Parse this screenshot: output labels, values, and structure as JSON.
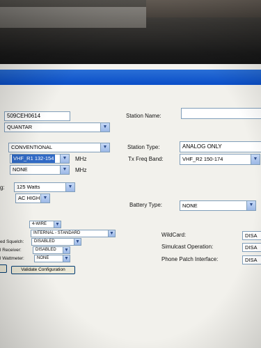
{
  "form": {
    "serial_value": "509CEH0614",
    "model_value": "QUANTAR",
    "station_name_label": "Station Name:",
    "station_name_value": "",
    "mode_value": "CONVENTIONAL",
    "station_type_label": "Station Type:",
    "station_type_value": "ANALOG ONLY",
    "rx_band_value": "VHF_R1  132-154",
    "rx_band_unit": "MHz",
    "tx_freq_band_label": "Tx Freq Band:",
    "tx_freq_band_value": "VHF_R2  150-174",
    "second_band_value": "NONE",
    "second_band_unit": "MHz",
    "power_label_fragment": "g:",
    "power_value": "125 Watts",
    "ac_value": "AC HIGH",
    "battery_type_label": "Battery Type:",
    "battery_type_value": "NONE",
    "wire_value": "4-WIRE",
    "internal_value": "INTERNAL - STANDARD",
    "squelch_label_fragment": "ed Squelch:",
    "squelch_value": "DISABLED",
    "receiver_label_fragment": "l Receiver:",
    "receiver_value": "DISABLED",
    "wattmeter_label_fragment": "l Wattmeter:",
    "wattmeter_value": "NONE",
    "validate_button": "Validate Configuration",
    "wildcard_label": "WildCard:",
    "wildcard_value": "DISA",
    "simulcast_label": "Simulcast Operation:",
    "simulcast_value": "DISA",
    "phone_patch_label": "Phone Patch Interface:",
    "phone_patch_value": "DISA"
  },
  "icons": {
    "dropdown": "chevron-down-icon"
  },
  "colors": {
    "titlebar": "#0a4ec8",
    "selection": "#316ac5",
    "field_border": "#7f9db9"
  }
}
